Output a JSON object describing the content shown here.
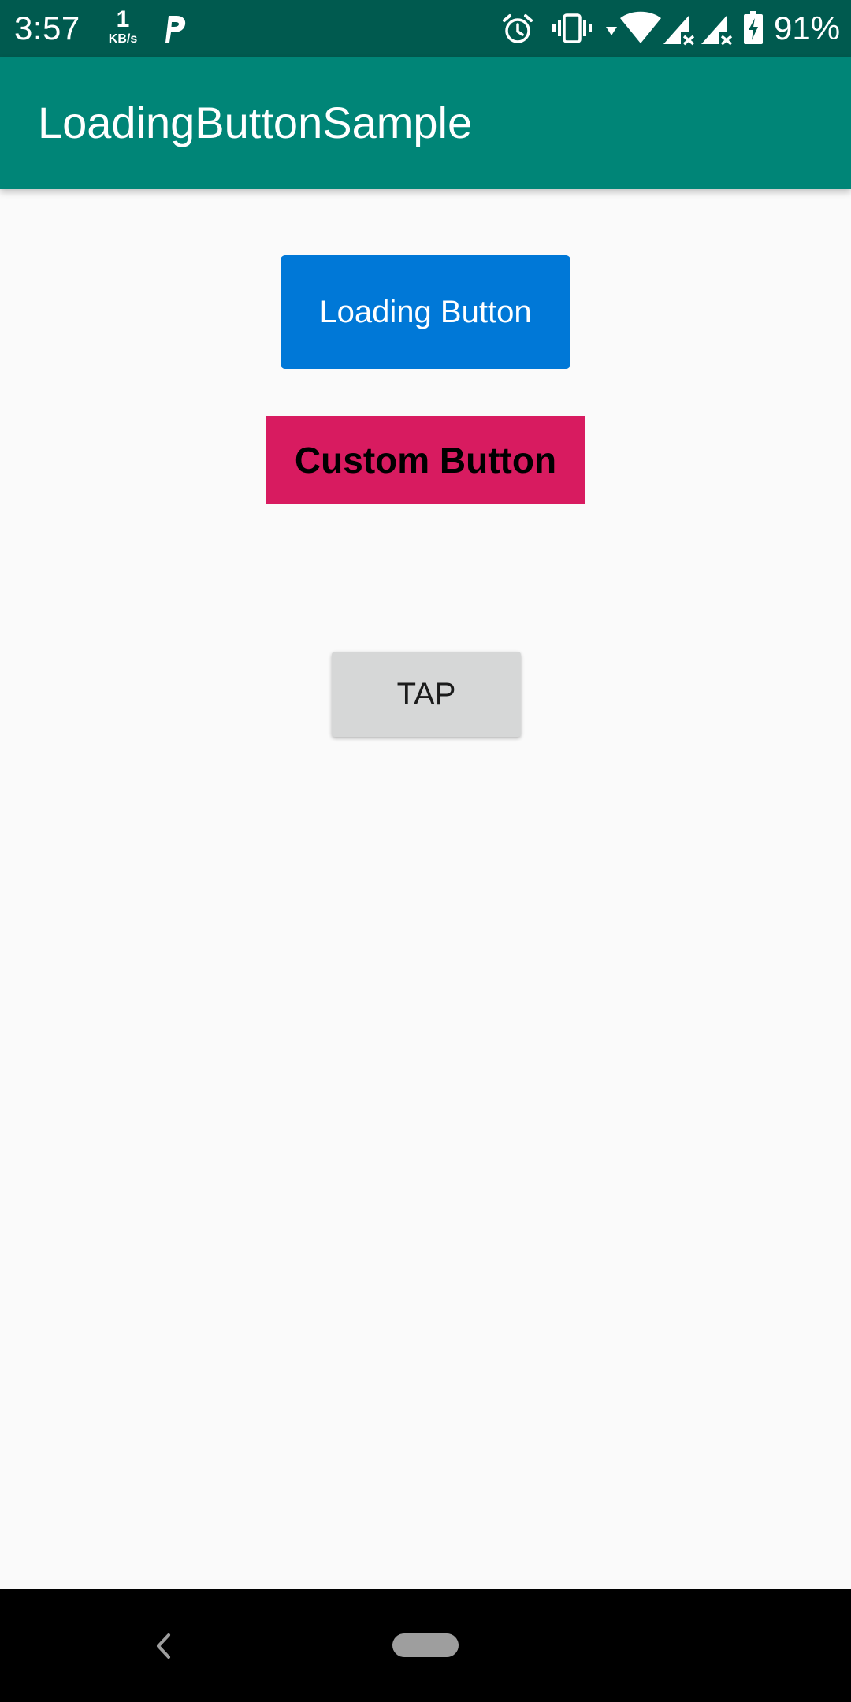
{
  "status_bar": {
    "time": "3:57",
    "net_speed_value": "1",
    "net_speed_unit": "KB/s",
    "battery_percent": "91%",
    "icons": [
      "p-app-icon",
      "alarm-icon",
      "vibrate-icon",
      "data-arrow-icon",
      "wifi-icon",
      "signal-no-service-icon",
      "signal-no-service-icon",
      "battery-charging-icon"
    ]
  },
  "app_bar": {
    "title": "LoadingButtonSample"
  },
  "main": {
    "loading_button": {
      "label": "Loading Button",
      "color": "#0078d7"
    },
    "custom_button": {
      "label": "Custom Button",
      "color": "#d81b60"
    },
    "tap_button": {
      "label": "TAP",
      "color": "#d6d7d7"
    }
  },
  "nav_bar": {
    "icons": [
      "back-icon",
      "home-pill-icon"
    ]
  },
  "colors": {
    "status_bar": "#005a4f",
    "app_bar": "#008577",
    "background": "#fafafa"
  }
}
